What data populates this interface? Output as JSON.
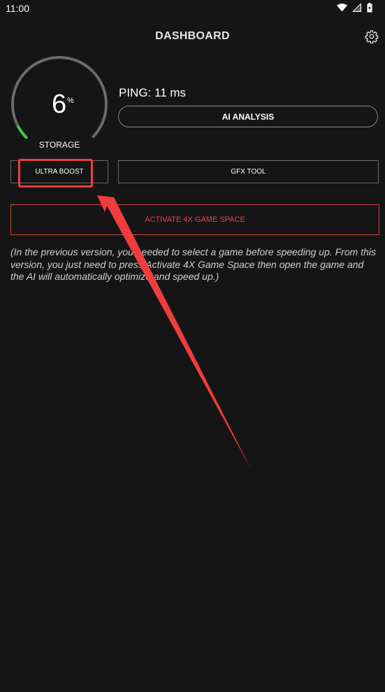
{
  "status_bar": {
    "time": "11:00",
    "icons": [
      "wifi-icon",
      "cellular-icon",
      "battery-icon"
    ]
  },
  "header": {
    "title": "DASHBOARD",
    "settings_icon": "gear-icon"
  },
  "storage_gauge": {
    "value": "6",
    "unit": "%",
    "label": "STORAGE",
    "fill_fraction": 0.06,
    "track_color": "#6b6b6b",
    "fill_color": "#3dcc4a"
  },
  "ping": {
    "text": "PING: 11 ms"
  },
  "buttons": {
    "ai_analysis": "AI ANALYSIS",
    "ultra_boost": "ULTRA BOOST",
    "gfx_tool": "GFX TOOL",
    "activate": "ACTIVATE 4X GAME SPACE"
  },
  "note": "(In the previous version, you needed to select a game before speeding up. From this version, you just need to press Activate 4X Game Space then open the game and the AI will automatically optimize and speed up.)",
  "annotation": {
    "color": "#ef3d3d"
  }
}
